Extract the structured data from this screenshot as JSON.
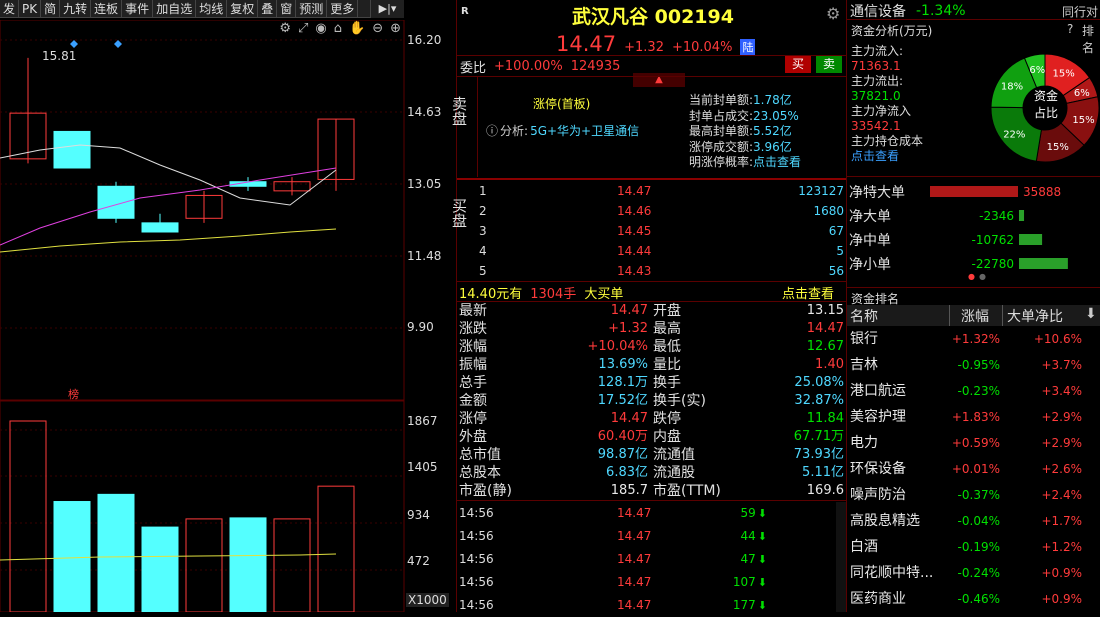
{
  "toolbar": {
    "items": [
      "发",
      "PK",
      "简",
      "九转",
      "连板",
      "事件",
      "加自选",
      "均线",
      "复权",
      "叠",
      "窗",
      "预测",
      "更多"
    ]
  },
  "chart": {
    "price_ticks": [
      "16.20",
      "14.63",
      "13.05",
      "11.48",
      "9.90"
    ],
    "high_label": "15.81",
    "volume_ticks": [
      "1867",
      "1405",
      "934",
      "472"
    ],
    "volume_unit": "X1000",
    "marker": "榜"
  },
  "chart_data": {
    "type": "candlestick",
    "price_ylim": [
      9.9,
      16.2
    ],
    "candles": [
      {
        "o": 13.6,
        "c": 14.6,
        "h": 15.81,
        "l": 13.5,
        "up": true
      },
      {
        "o": 14.2,
        "c": 13.4,
        "h": 14.2,
        "l": 13.4,
        "up": false
      },
      {
        "o": 13.0,
        "c": 12.3,
        "h": 13.1,
        "l": 12.2,
        "up": false
      },
      {
        "o": 12.2,
        "c": 12.0,
        "h": 12.4,
        "l": 12.0,
        "up": false
      },
      {
        "o": 12.3,
        "c": 12.8,
        "h": 12.9,
        "l": 12.2,
        "up": true
      },
      {
        "o": 13.1,
        "c": 13.0,
        "h": 13.2,
        "l": 12.9,
        "up": false
      },
      {
        "o": 12.9,
        "c": 13.1,
        "h": 13.2,
        "l": 12.8,
        "up": true
      },
      {
        "o": 13.15,
        "c": 14.47,
        "h": 14.47,
        "l": 12.9,
        "up": true
      }
    ],
    "volumes": [
      1867,
      1080,
      1150,
      830,
      910,
      920,
      910,
      1230
    ],
    "volume_ylim": [
      0,
      1867
    ]
  },
  "stock": {
    "badge": "R",
    "name": "武汉凡谷 002194",
    "price": "14.47",
    "change": "+1.32",
    "pct": "+10.04%",
    "tag": "陆"
  },
  "weibi": {
    "label": "委比",
    "value": "+100.00%",
    "volume": "124935",
    "sell_btn": "买",
    "buy_btn": "卖"
  },
  "sell_panel": {
    "side_label": "卖盘",
    "zt_title": "涨停(首板)",
    "analysis_label": "分析:",
    "analysis": "5G+华为+卫星通信",
    "stats": [
      {
        "k": "当前封单额:",
        "v": "1.78亿"
      },
      {
        "k": "封单占成交:",
        "v": "23.05%"
      },
      {
        "k": "最高封单额:",
        "v": "5.52亿"
      },
      {
        "k": "涨停成交额:",
        "v": "3.96亿"
      },
      {
        "k": "明涨停概率:",
        "v": "点击查看"
      }
    ]
  },
  "buy_panel": {
    "side_label": "买盘",
    "rows": [
      {
        "n": "1",
        "p": "14.47",
        "v": "123127"
      },
      {
        "n": "2",
        "p": "14.46",
        "v": "1680"
      },
      {
        "n": "3",
        "p": "14.45",
        "v": "67"
      },
      {
        "n": "4",
        "p": "14.44",
        "v": "5"
      },
      {
        "n": "5",
        "p": "14.43",
        "v": "56"
      }
    ]
  },
  "big_order": {
    "price": "14.40元有",
    "qty": "1304手",
    "label": "大买单",
    "link": "点击查看"
  },
  "quote": [
    {
      "k1": "最新",
      "v1": "14.47",
      "c1": "red",
      "k2": "开盘",
      "v2": "13.15",
      "c2": "white"
    },
    {
      "k1": "涨跌",
      "v1": "+1.32",
      "c1": "red",
      "k2": "最高",
      "v2": "14.47",
      "c2": "red"
    },
    {
      "k1": "涨幅",
      "v1": "+10.04%",
      "c1": "red",
      "k2": "最低",
      "v2": "12.67",
      "c2": "green"
    },
    {
      "k1": "振幅",
      "v1": "13.69%",
      "c1": "cyan",
      "k2": "量比",
      "v2": "1.40",
      "c2": "red"
    },
    {
      "k1": "总手",
      "v1": "128.1万",
      "c1": "cyan",
      "k2": "换手",
      "v2": "25.08%",
      "c2": "cyan"
    },
    {
      "k1": "金额",
      "v1": "17.52亿",
      "c1": "cyan",
      "k2": "换手(实)",
      "v2": "32.87%",
      "c2": "cyan"
    },
    {
      "k1": "涨停",
      "v1": "14.47",
      "c1": "red",
      "k2": "跌停",
      "v2": "11.84",
      "c2": "green"
    },
    {
      "k1": "外盘",
      "v1": "60.40万",
      "c1": "red",
      "k2": "内盘",
      "v2": "67.71万",
      "c2": "green"
    },
    {
      "k1": "总市值",
      "v1": "98.87亿",
      "c1": "cyan",
      "k2": "流通值",
      "v2": "73.93亿",
      "c2": "cyan"
    },
    {
      "k1": "总股本",
      "v1": "6.83亿",
      "c1": "cyan",
      "k2": "流通股",
      "v2": "5.11亿",
      "c2": "cyan"
    },
    {
      "k1": "市盈(静)",
      "v1": "185.7",
      "c1": "white",
      "k2": "市盈(TTM)",
      "v2": "169.6",
      "c2": "white"
    }
  ],
  "ticks": [
    {
      "t": "14:56",
      "p": "14.47",
      "v": "59",
      "n": "8"
    },
    {
      "t": "14:56",
      "p": "14.47",
      "v": "44",
      "n": "5"
    },
    {
      "t": "14:56",
      "p": "14.47",
      "v": "47",
      "n": "7"
    },
    {
      "t": "14:56",
      "p": "14.47",
      "v": "107",
      "n": "8"
    },
    {
      "t": "14:56",
      "p": "14.47",
      "v": "177",
      "n": "5"
    }
  ],
  "sector": {
    "name": "通信设备",
    "pct": "-1.34%",
    "link": "同行对"
  },
  "fund": {
    "title": "资金分析(万元)",
    "rank_link": "排名",
    "items": [
      {
        "k": "主力流入:",
        "v": "71363.1",
        "c": "red"
      },
      {
        "k": "主力流出:",
        "v": "37821.0",
        "c": "green"
      },
      {
        "k": "主力净流入",
        "v": "33542.1",
        "c": "red"
      },
      {
        "k": "主力持仓成本",
        "v": "点击查看",
        "c": "blue"
      }
    ],
    "donut_center": "资金占比",
    "donut": [
      {
        "label": "15%",
        "color": "#e02020",
        "value": 15
      },
      {
        "label": "6%",
        "color": "#b01818",
        "value": 6
      },
      {
        "label": "15%",
        "color": "#8a1010",
        "value": 15
      },
      {
        "label": "15%",
        "color": "#6a0c0c",
        "value": 15
      },
      {
        "label": "22%",
        "color": "#0a7a0a",
        "value": 22
      },
      {
        "label": "18%",
        "color": "#10a010",
        "value": 18
      },
      {
        "label": "6%",
        "color": "#20c020",
        "value": 6
      }
    ]
  },
  "net": [
    {
      "k": "净特大单",
      "v": "35888",
      "c": "red",
      "val": 35888
    },
    {
      "k": "净大单",
      "v": "-2346",
      "c": "green",
      "val": -2346
    },
    {
      "k": "净中单",
      "v": "-10762",
      "c": "green",
      "val": -10762
    },
    {
      "k": "净小单",
      "v": "-22780",
      "c": "green",
      "val": -22780
    }
  ],
  "rank": {
    "title": "资金排名",
    "headers": [
      "名称",
      "涨幅",
      "大单净比"
    ],
    "rows": [
      {
        "n": "银行",
        "p": "+1.32%",
        "b": "+10.6%"
      },
      {
        "n": "吉林",
        "p": "-0.95%",
        "b": "+3.7%"
      },
      {
        "n": "港口航运",
        "p": "-0.23%",
        "b": "+3.4%"
      },
      {
        "n": "美容护理",
        "p": "+1.83%",
        "b": "+2.9%"
      },
      {
        "n": "电力",
        "p": "+0.59%",
        "b": "+2.9%"
      },
      {
        "n": "环保设备",
        "p": "+0.01%",
        "b": "+2.6%"
      },
      {
        "n": "噪声防治",
        "p": "-0.37%",
        "b": "+2.4%"
      },
      {
        "n": "高股息精选",
        "p": "-0.04%",
        "b": "+1.7%"
      },
      {
        "n": "白酒",
        "p": "-0.19%",
        "b": "+1.2%"
      },
      {
        "n": "同花顺中特...",
        "p": "-0.24%",
        "b": "+0.9%"
      },
      {
        "n": "医药商业",
        "p": "-0.46%",
        "b": "+0.9%"
      }
    ]
  }
}
